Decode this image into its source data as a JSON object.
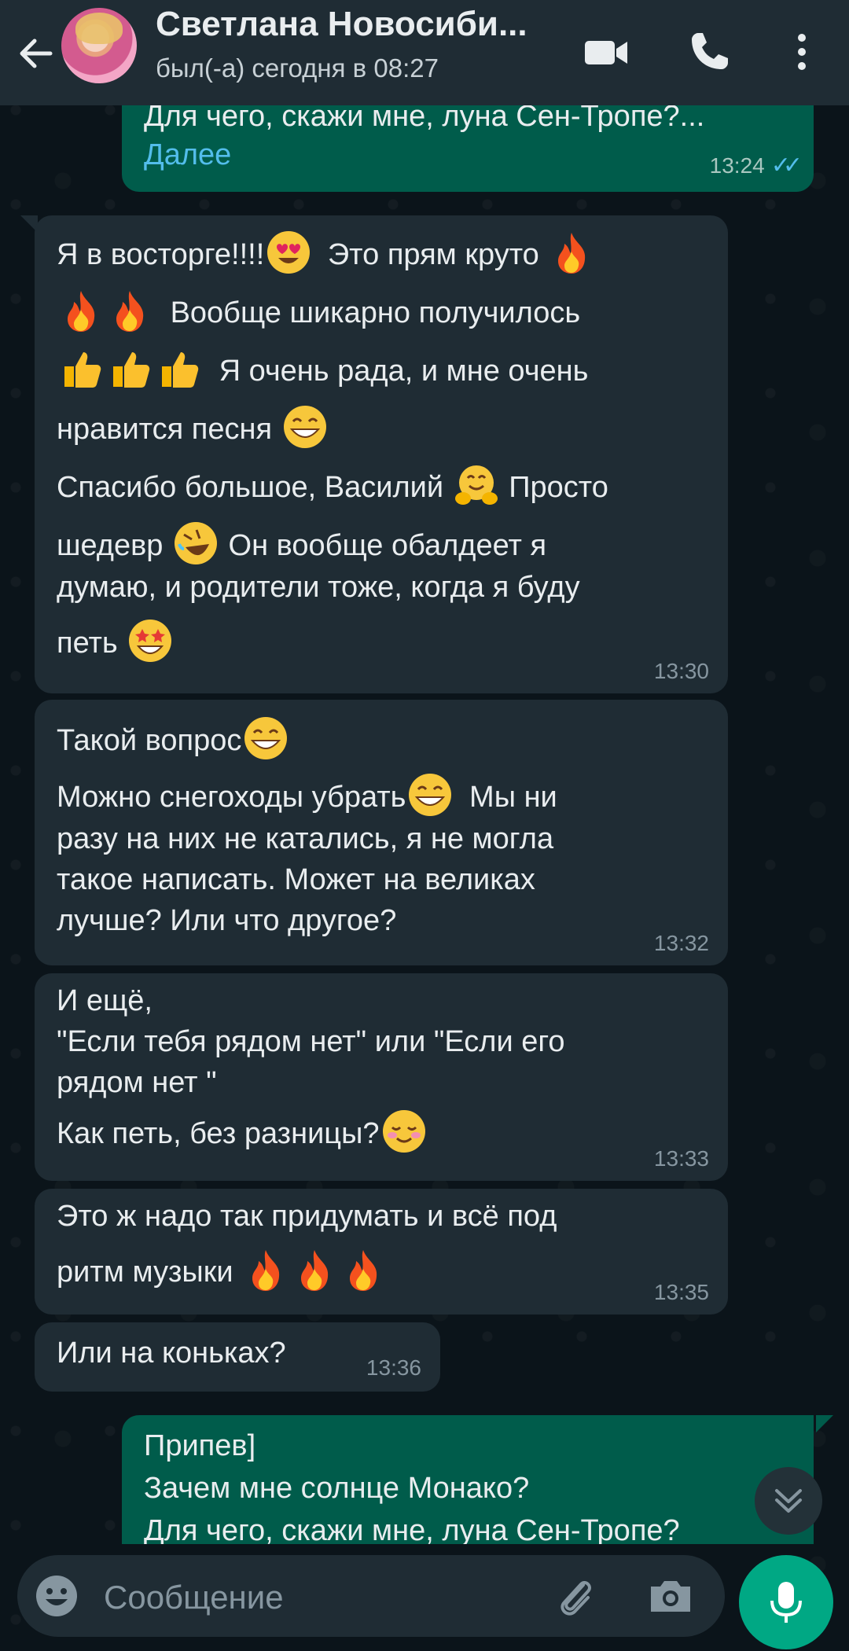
{
  "header": {
    "contact_name": "Светлана Новосиби...",
    "status": "был(-а) сегодня в 08:27"
  },
  "messages": [
    {
      "direction": "out",
      "lines": [
        "Для чего, скажи мне, луна Сен-Тропе?..."
      ],
      "link": "Далее",
      "time": "13:24",
      "read": true
    },
    {
      "direction": "in",
      "lines": [
        "Я в восторге!!!!",
        "Это прям круто",
        "Вообще шикарно получилось",
        "Я очень рада, и мне очень",
        "нравится песня",
        "Спасибо большое, Василий",
        "Просто",
        "шедевр",
        "Он вообще обалдеет я",
        "думаю, и родители тоже, когда я буду",
        "петь"
      ],
      "time": "13:30"
    },
    {
      "direction": "in",
      "lines": [
        "Такой вопрос",
        "Можно снегоходы убрать",
        "Мы ни",
        "разу на них не катались, я не могла",
        "такое написать. Может на великах",
        "лучше? Или что другое?"
      ],
      "time": "13:32"
    },
    {
      "direction": "in",
      "lines": [
        "И ещё,",
        "\"Если тебя рядом нет\" или \"Если его",
        "рядом нет \"",
        "Как петь, без разницы?"
      ],
      "time": "13:33"
    },
    {
      "direction": "in",
      "lines": [
        "Это ж надо так придумать и всё под",
        "ритм музыки"
      ],
      "time": "13:35"
    },
    {
      "direction": "in",
      "lines": [
        "Или на коньках?"
      ],
      "time": "13:36"
    },
    {
      "direction": "out",
      "lines": [
        "Припев]",
        "Зачем мне солнце Монако?",
        "Для чего, скажи мне, луна Сен-Тропе?"
      ]
    }
  ],
  "composer": {
    "placeholder": "Сообщение"
  },
  "icons": {
    "back": "arrow-left-icon",
    "video": "video-camera-icon",
    "call": "phone-icon",
    "more": "more-vertical-icon",
    "emoji": "emoji-icon",
    "attach": "paperclip-icon",
    "camera": "camera-icon",
    "mic": "microphone-icon",
    "scroll": "chevron-double-down-icon"
  },
  "colors": {
    "background": "#0b141a",
    "header": "#1f2c34",
    "incoming_bubble": "#1f2c34",
    "outgoing_bubble": "#005c4b",
    "accent": "#00a884",
    "read_ticks": "#53bdeb"
  }
}
